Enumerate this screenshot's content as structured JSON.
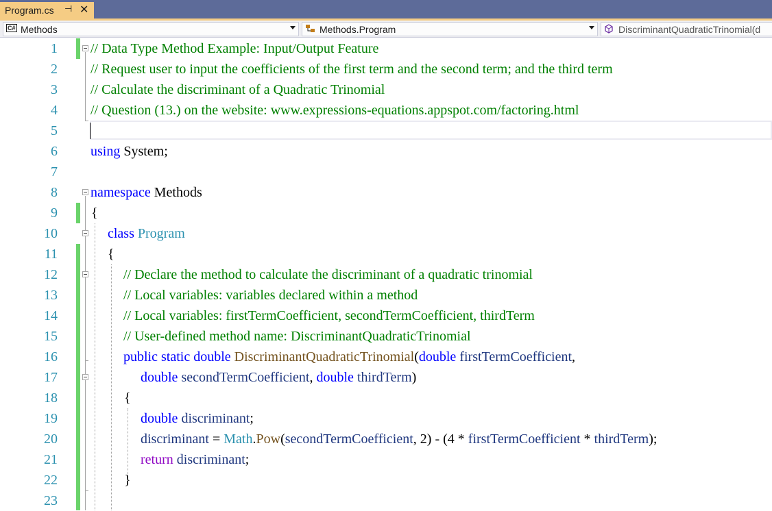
{
  "tab": {
    "title": "Program.cs",
    "pin_glyph": "⊣",
    "close_glyph": "✕"
  },
  "navbar": {
    "project": "Methods",
    "project_icon": "C#",
    "type": "Methods.Program",
    "member": "DiscriminantQuadraticTrinomial(d"
  },
  "editor": {
    "line_numbers": [
      "1",
      "2",
      "3",
      "4",
      "5",
      "6",
      "7",
      "8",
      "9",
      "10",
      "11",
      "12",
      "13",
      "14",
      "15",
      "16",
      "17",
      "18",
      "19",
      "20",
      "21",
      "22",
      "23"
    ],
    "lines": {
      "l1_comment": "// Data Type Method Example: Input/Output Feature",
      "l2_comment": "// Request user to input the coefficients of the first term and the second term; and the third term",
      "l3_comment": "// Calculate the discriminant of a Quadratic Trinomial",
      "l4_comment": "// Question (13.) on the website: www.expressions-equations.appspot.com/factoring.html",
      "l6_kw": "using",
      "l6_rest": " System;",
      "l8_kw": "namespace",
      "l8_rest": " Methods",
      "l9": "{",
      "l10_kw": "class",
      "l10_type": "Program",
      "l11": "{",
      "l12_comment": "// Declare the method to calculate the discriminant of a quadratic trinomial",
      "l13_comment": "// Local variables: variables declared within a method",
      "l14_comment": "// Local variables: firstTermCoefficient, secondTermCoefficient, thirdTerm",
      "l15_comment": "// User-defined method name: DiscriminantQuadraticTrinomial",
      "l16_kw": "public static double",
      "l16_method": "DiscriminantQuadraticTrinomial",
      "l16_paren": "(",
      "l16_kw2": "double",
      "l16_param": "firstTermCoefficient",
      "l16_comma": ",",
      "l17_kw": "double",
      "l17_param": "secondTermCoefficient",
      "l17_comma": ",",
      "l17_kw2": "double",
      "l17_param2": "thirdTerm",
      "l17_close": ")",
      "l18": "{",
      "l19_kw": "double",
      "l19_var": "discriminant",
      "l19_semi": ";",
      "l20_var": "discriminant",
      "l20_eq": " = ",
      "l20_type": "Math",
      "l20_dot": ".",
      "l20_method": "Pow",
      "l20_open": "(",
      "l20_p1": "secondTermCoefficient",
      "l20_mid": ", 2) - (4 * ",
      "l20_p2": "firstTermCoefficient",
      "l20_star": " * ",
      "l20_p3": "thirdTerm",
      "l20_end": ");",
      "l21_kw": "return",
      "l21_var": "discriminant",
      "l21_semi": ";",
      "l22": "}"
    }
  },
  "colors": {
    "tab_active": "#f5cc84",
    "tab_strip": "#5d6b99",
    "comment": "#008000",
    "keyword": "#0000ff",
    "control_keyword": "#8f08c4",
    "type": "#2b91af",
    "method": "#74531f",
    "parameter": "#1f377f",
    "line_number": "#2b91af",
    "change_margin": "#6ad36a"
  }
}
